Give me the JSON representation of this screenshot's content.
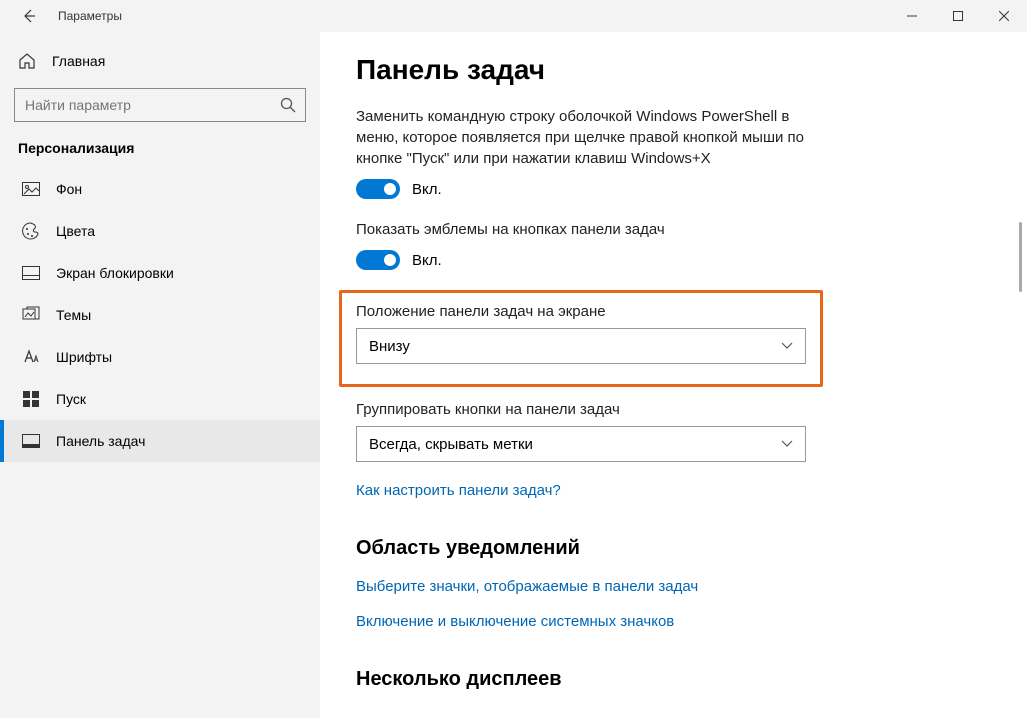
{
  "window": {
    "title": "Параметры"
  },
  "sidebar": {
    "home": "Главная",
    "search_placeholder": "Найти параметр",
    "section": "Персонализация",
    "items": [
      {
        "label": "Фон"
      },
      {
        "label": "Цвета"
      },
      {
        "label": "Экран блокировки"
      },
      {
        "label": "Темы"
      },
      {
        "label": "Шрифты"
      },
      {
        "label": "Пуск"
      },
      {
        "label": "Панель задач"
      }
    ]
  },
  "content": {
    "h1": "Панель задач",
    "setting1": {
      "desc": "Заменить командную строку оболочкой Windows PowerShell в меню, которое появляется при щелчке правой кнопкой мыши по кнопке \"Пуск\" или при нажатии клавиш Windows+X",
      "state": "Вкл."
    },
    "setting2": {
      "desc": "Показать эмблемы на кнопках панели задач",
      "state": "Вкл."
    },
    "position": {
      "label": "Положение панели задач на экране",
      "value": "Внизу"
    },
    "grouping": {
      "label": "Группировать кнопки на панели задач",
      "value": "Всегда, скрывать метки"
    },
    "help_link": "Как настроить панели задач?",
    "section2": {
      "h2": "Область уведомлений",
      "link1": "Выберите значки, отображаемые в панели задач",
      "link2": "Включение и выключение системных значков"
    },
    "section3": {
      "h2": "Несколько дисплеев"
    }
  }
}
